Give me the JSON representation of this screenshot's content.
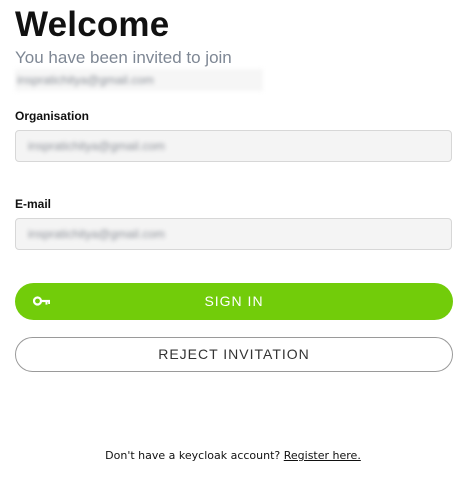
{
  "header": {
    "title": "Welcome",
    "subtitle": "You have been invited to join",
    "invite_email": "inspratichitya@gmail.com"
  },
  "form": {
    "organisation": {
      "label": "Organisation",
      "value": "inspratichitya@gmail.com"
    },
    "email": {
      "label": "E-mail",
      "value": "inspratichitya@gmail.com"
    }
  },
  "actions": {
    "sign_in_label": "SIGN IN",
    "sign_in_icon": "key-icon",
    "reject_label": "REJECT INVITATION"
  },
  "footer": {
    "prompt": "Don't have a keycloak account?",
    "register_link": "Register here."
  },
  "colors": {
    "accent": "#72cc0a",
    "subtitle": "#7e8794",
    "field_background": "#f4f4f4"
  }
}
